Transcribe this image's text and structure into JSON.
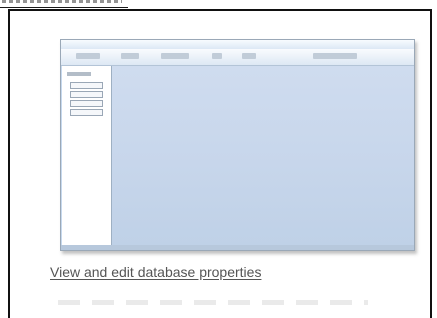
{
  "colors": {
    "panel_border": "#111111",
    "thumbnail_background": "#c7d9ee",
    "link_text": "#555555"
  },
  "panel": {
    "properties_link": "View and edit database properties"
  },
  "icons": {
    "thumbnail": "database-window-thumbnail"
  }
}
